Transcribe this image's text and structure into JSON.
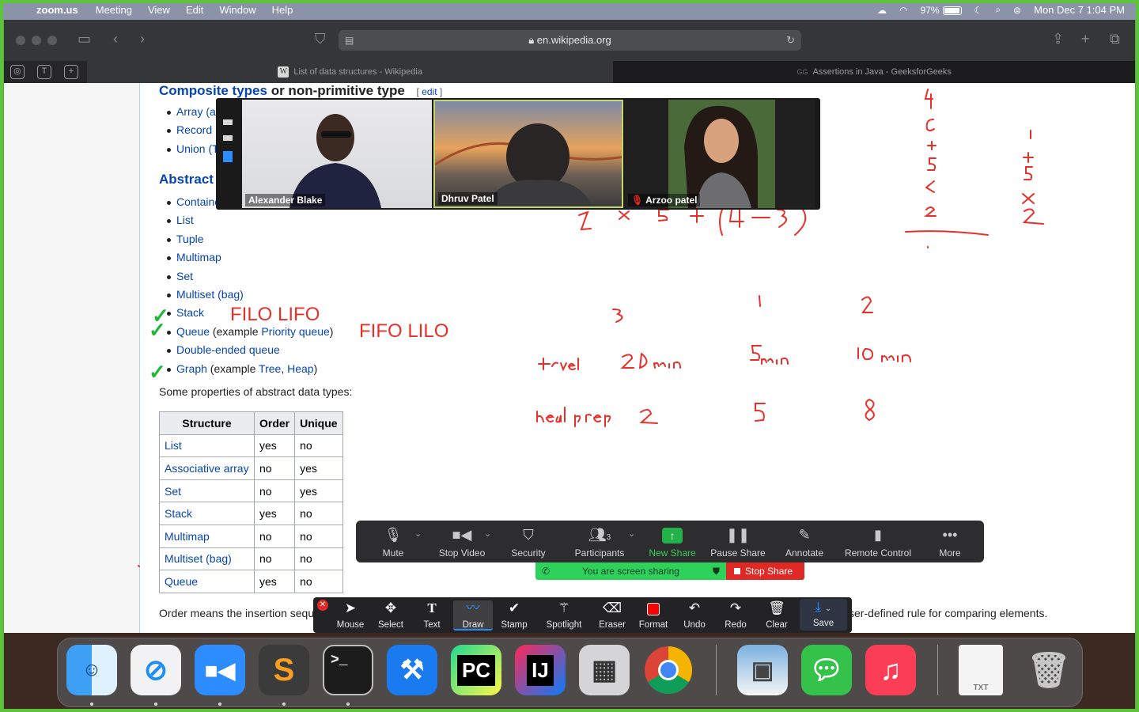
{
  "menubar": {
    "apple": "",
    "app_name": "zoom.us",
    "items": [
      "Meeting",
      "View",
      "Edit",
      "Window",
      "Help"
    ],
    "battery": "97%",
    "datetime": "Mon Dec 7  1:04 PM"
  },
  "browser": {
    "url": "en.wikipedia.org",
    "tabs": [
      {
        "title": "List of data structures - Wikipedia",
        "active": true,
        "favicon": "W"
      },
      {
        "title": "Assertions in Java - GeeksforGeeks",
        "active": false,
        "favicon": "GG"
      }
    ]
  },
  "page": {
    "composite_heading": "Composite types",
    "composite_heading_rest": " or non-primitive type",
    "edit_label": "edit",
    "composite_items": [
      "Array (a",
      "Record",
      "Union (T"
    ],
    "abstract_heading": "Abstract",
    "abstract_items": [
      {
        "link": "Containe",
        "rest": ""
      },
      {
        "link": "List",
        "rest": ""
      },
      {
        "link": "Tuple",
        "rest": ""
      },
      {
        "link": "Multimap",
        "rest": ""
      },
      {
        "link": "Set",
        "rest": ""
      },
      {
        "link": "Multiset (bag)",
        "rest": ""
      },
      {
        "link": "Stack",
        "rest": ""
      },
      {
        "link": "Queue",
        "rest": " (example ",
        "link2": "Priority queue",
        "end": ")"
      },
      {
        "link": "Double-ended queue",
        "rest": ""
      },
      {
        "link": "Graph",
        "rest": " (example ",
        "link2": "Tree",
        "sep": ", ",
        "link3": "Heap",
        "end": ")"
      }
    ],
    "properties_text": "Some properties of abstract data types:",
    "table": {
      "headers": [
        "Structure",
        "Order",
        "Unique"
      ],
      "rows": [
        [
          "List",
          "yes",
          "no"
        ],
        [
          "Associative array",
          "no",
          "yes"
        ],
        [
          "Set",
          "no",
          "yes"
        ],
        [
          "Stack",
          "yes",
          "no"
        ],
        [
          "Multimap",
          "no",
          "no"
        ],
        [
          "Multiset (bag)",
          "no",
          "no"
        ],
        [
          "Queue",
          "yes",
          "no"
        ]
      ]
    },
    "order_text_start": "Order means the insertion sequ",
    "order_text_end": "ser-defined rule for comparing elements."
  },
  "annotations": {
    "filo_lifo": "FILO LIFO",
    "fifo_lilo": "FIFO LILO",
    "color": "#e8302a",
    "check_color": "#1fb83d"
  },
  "video": {
    "participants": [
      {
        "name": "Alexander Blake",
        "speaking": false
      },
      {
        "name": "Dhruv Patel",
        "speaking": true
      },
      {
        "name": "Arzoo patel",
        "speaking": false
      }
    ]
  },
  "controls": {
    "mute": "Mute",
    "stop_video": "Stop Video",
    "security": "Security",
    "participants": "Participants",
    "participants_count": "3",
    "new_share": "New Share",
    "pause_share": "Pause Share",
    "annotate": "Annotate",
    "remote_control": "Remote Control",
    "more": "More",
    "sharing_status": "You are screen sharing",
    "stop_share": "Stop Share"
  },
  "annotate_toolbar": {
    "mouse": "Mouse",
    "select": "Select",
    "text": "Text",
    "draw": "Draw",
    "stamp": "Stamp",
    "spotlight": "Spotlight",
    "eraser": "Eraser",
    "format": "Format",
    "undo": "Undo",
    "redo": "Redo",
    "clear": "Clear",
    "save": "Save"
  },
  "dock": {
    "apps": [
      "Finder",
      "Safari",
      "Zoom",
      "Sublime Text",
      "Terminal",
      "Xcode",
      "PyCharm",
      "IntelliJ IDEA",
      "Calculator",
      "Chrome",
      "Preview",
      "Messages",
      "Music",
      "TXT",
      "Trash"
    ],
    "txt_label": "TXT"
  }
}
